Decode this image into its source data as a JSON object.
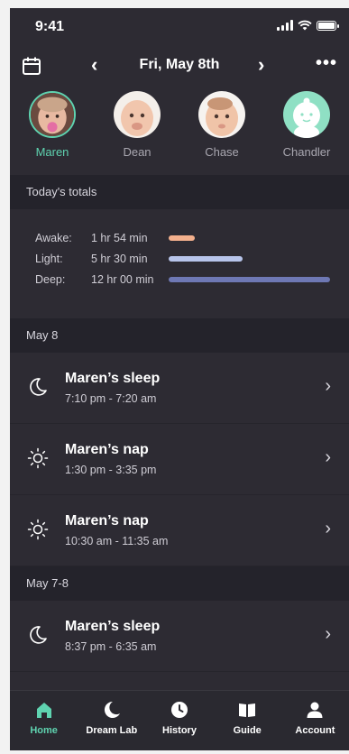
{
  "status": {
    "time": "9:41"
  },
  "header": {
    "date": "Fri, May 8th",
    "prev": "‹",
    "next": "›",
    "more": "•••"
  },
  "children": [
    {
      "name": "Maren",
      "selected": true
    },
    {
      "name": "Dean"
    },
    {
      "name": "Chase"
    },
    {
      "name": "Chandler"
    }
  ],
  "totals": {
    "heading": "Today's totals",
    "rows": [
      {
        "label": "Awake:",
        "value": "1 hr 54 min",
        "fraction": 0.15,
        "color": "#f3b08d"
      },
      {
        "label": "Light:",
        "value": "5 hr 30 min",
        "fraction": 0.43,
        "color": "#b7c4ea"
      },
      {
        "label": "Deep:",
        "value": "12 hr 00 min",
        "fraction": 0.94,
        "color": "#6e78b4"
      }
    ]
  },
  "groups": [
    {
      "heading": "May 8",
      "entries": [
        {
          "icon": "moon-icon",
          "title": "Maren’s sleep",
          "range": "7:10 pm - 7:20 am"
        },
        {
          "icon": "sun-icon",
          "title": "Maren’s nap",
          "range": "1:30 pm - 3:35 pm"
        },
        {
          "icon": "sun-icon",
          "title": "Maren’s nap",
          "range": "10:30 am - 11:35 am"
        }
      ]
    },
    {
      "heading": "May 7-8",
      "entries": [
        {
          "icon": "moon-icon",
          "title": "Maren’s sleep",
          "range": "8:37 pm - 6:35 am"
        }
      ]
    }
  ],
  "tabs": [
    {
      "label": "Home",
      "icon": "home-icon",
      "active": true
    },
    {
      "label": "Dream Lab",
      "icon": "moon-icon"
    },
    {
      "label": "History",
      "icon": "clock-icon"
    },
    {
      "label": "Guide",
      "icon": "book-icon"
    },
    {
      "label": "Account",
      "icon": "person-icon"
    }
  ],
  "colors": {
    "accent": "#5fd3b0",
    "background": "#2d2b33",
    "section": "#24232b"
  }
}
